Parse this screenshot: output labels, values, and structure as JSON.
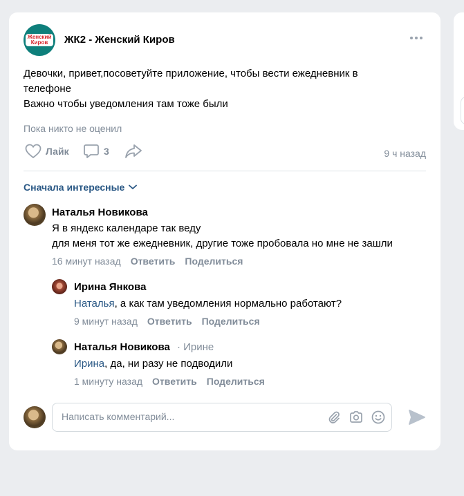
{
  "post": {
    "group_name": "ЖК2 - Женский Киров",
    "logo_line1": "Женский",
    "logo_line2": "Киров",
    "text_lines": [
      "Девочки, привет,посоветуйте приложение, чтобы вести ежедневник в",
      "телефоне",
      "Важно чтобы уведомления там тоже были"
    ],
    "no_likes": "Пока никто не оценил",
    "like_label": "Лайк",
    "comments_count": "3",
    "time": "9 ч назад"
  },
  "comments": {
    "sort_label": "Сначала интересные",
    "items": [
      {
        "author": "Наталья Новикова",
        "lines": [
          "Я в яндекс календаре так веду",
          "для меня тот же ежедневник, другие тоже пробовала но мне не зашли"
        ],
        "time": "16 минут назад",
        "reply": "Ответить",
        "share": "Поделиться"
      },
      {
        "author": "Ирина Янкова",
        "mention": "Наталья",
        "text": ", а как там уведомления нормально работают?",
        "time": "9 минут назад",
        "reply": "Ответить",
        "share": "Поделиться"
      },
      {
        "author": "Наталья Новикова",
        "reply_to": "· Ирине",
        "mention": "Ирина",
        "text": ", да, ни разу не подводили",
        "time": "1 минуту назад",
        "reply": "Ответить",
        "share": "Поделиться"
      }
    ]
  },
  "composer": {
    "placeholder": "Написать комментарий..."
  },
  "colors": {
    "accent": "#2a5885",
    "muted": "#818c99",
    "group_avatar": "#0e7f7b",
    "logo_red": "#d6262b"
  }
}
